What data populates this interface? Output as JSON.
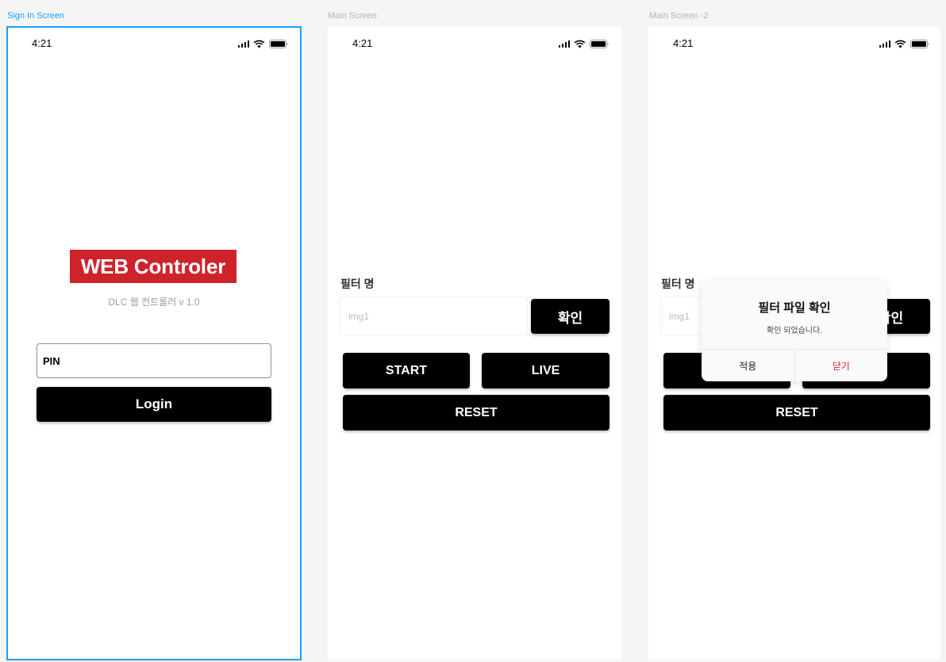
{
  "frames": {
    "signin": {
      "label": "Sign In Screen"
    },
    "main": {
      "label": "Main Screen"
    },
    "main2": {
      "label": "Main Screen -2"
    }
  },
  "status_bar": {
    "time": "4:21"
  },
  "signin": {
    "brand": "WEB Controler",
    "brand_color": "#cf232b",
    "subtitle": "DLC 웹 컨트롤러 v 1.0",
    "pin_placeholder": "PIN",
    "login_label": "Login"
  },
  "main": {
    "filter_label": "필터 명",
    "filter_placeholder": "img1",
    "confirm_label": "확인",
    "start_label": "START",
    "live_label": "LIVE",
    "reset_label": "RESET"
  },
  "modal": {
    "title": "필터 파일 확인",
    "message": "확인 되었습니다.",
    "apply_label": "적용",
    "close_label": "닫기",
    "close_color": "#d9232d"
  }
}
